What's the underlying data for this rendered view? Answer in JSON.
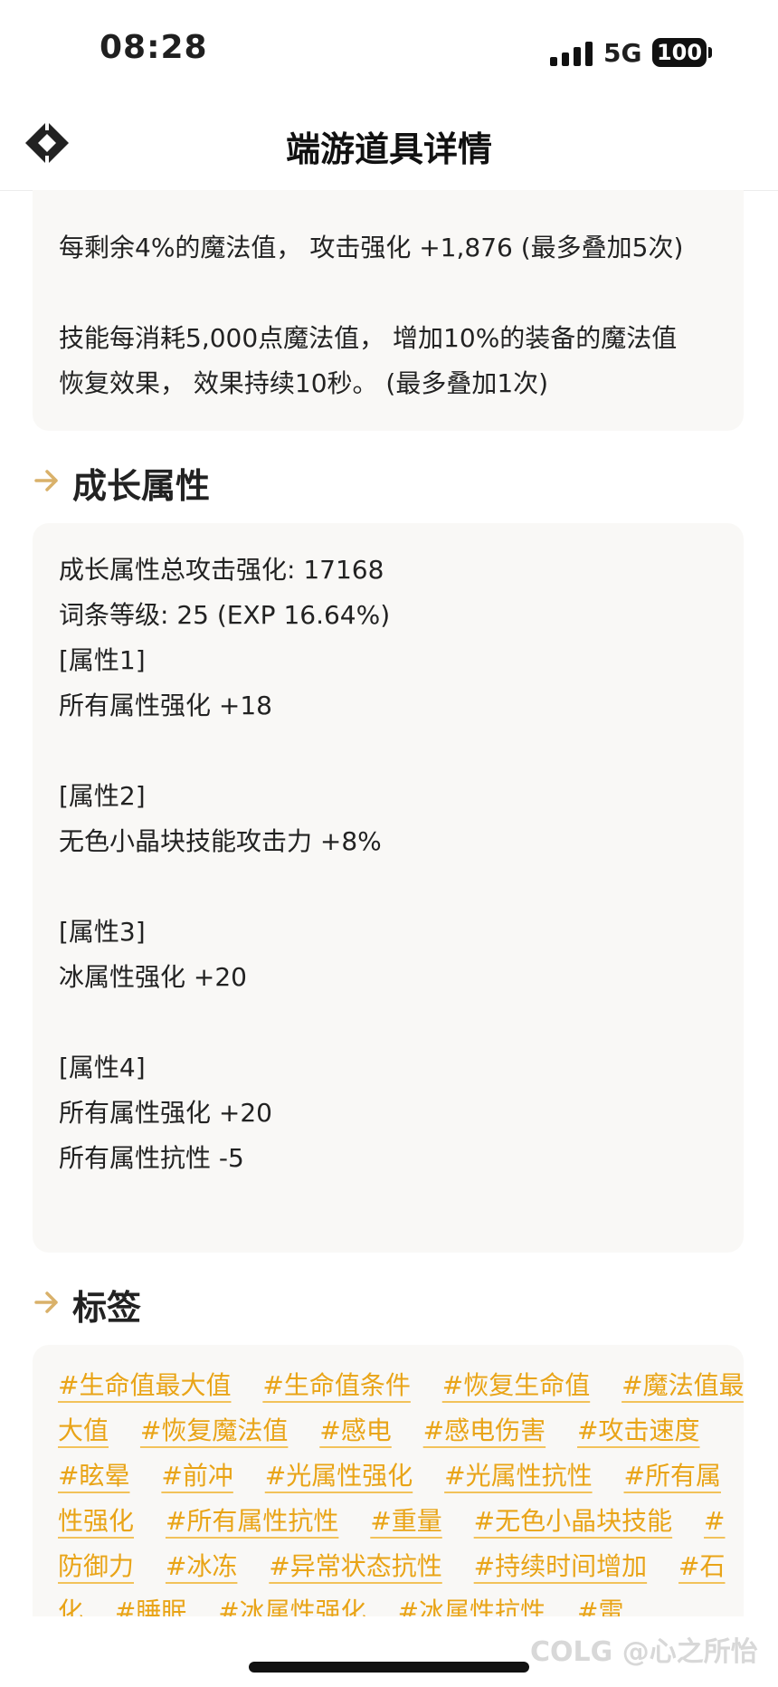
{
  "status_bar": {
    "time": "08:28",
    "network": "5G",
    "battery": "100"
  },
  "nav": {
    "title": "端游道具详情",
    "logo_icon": "diamond-logo-icon"
  },
  "description": {
    "line1": "每剩余4%的魔法值， 攻击强化 +1,876 (最多叠加5次)",
    "line2": "技能每消耗5,000点魔法值， 增加10%的装备的魔法值",
    "line3": "恢复效果， 效果持续10秒。 (最多叠加1次)"
  },
  "growth": {
    "title": "成长属性",
    "total": "成长属性总攻击强化: 17168",
    "level": "词条等级: 25 (EXP 16.64%)",
    "attr1_label": "[属性1]",
    "attr1_value": "所有属性强化 +18",
    "attr2_label": "[属性2]",
    "attr2_value": "无色小晶块技能攻击力 +8%",
    "attr3_label": "[属性3]",
    "attr3_value": "冰属性强化 +20",
    "attr4_label": "[属性4]",
    "attr4_value1": "所有属性强化 +20",
    "attr4_value2": "所有属性抗性 -5"
  },
  "tags": {
    "title": "标签",
    "items": [
      "#生命值最大值",
      "#生命值条件",
      "#恢复生命值",
      "#魔法值最大值",
      "#恢复魔法值",
      "#感电",
      "#感电伤害",
      "#攻击速度",
      "#眩晕",
      "#前冲",
      "#光属性强化",
      "#光属性抗性",
      "#所有属性强化",
      "#所有属性抗性",
      "#重量",
      "#无色小晶块技能",
      "#防御力",
      "#冰冻",
      "#异常状态抗性",
      "#持续时间增加",
      "#石化",
      "#睡眠",
      "#冰属性强化",
      "#冰属性抗性",
      "#雷"
    ]
  },
  "watermark": "COLG @心之所怡",
  "colors": {
    "accent": "#e9a417",
    "card": "#f9f8f6",
    "arrow": "#d9b16a"
  }
}
